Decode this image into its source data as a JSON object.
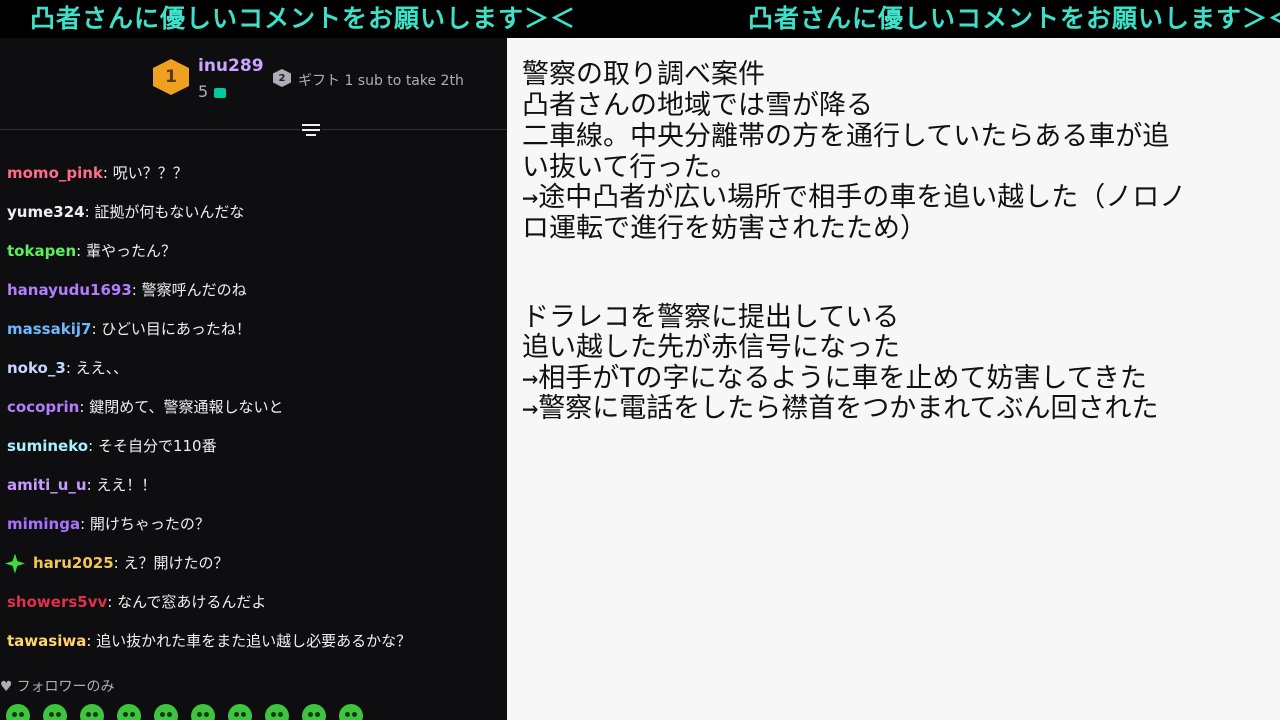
{
  "ticker": {
    "text": "凸者さんに優しいコメントをお願いします＞＜",
    "text_repeat": "凸者さんに優しいコメントをお願いします＞＜"
  },
  "pinned": {
    "rank1": "1",
    "user": "inu289",
    "count": "5",
    "rank2": "2",
    "message": "ギフト 1 sub to take 2th"
  },
  "chat": [
    {
      "user": "momo_pink",
      "color": "#ff6b8a",
      "text": "呪い？？？"
    },
    {
      "user": "yume324",
      "color": "#efeff1",
      "text": "証拠が何もないんだな"
    },
    {
      "user": "tokapen",
      "color": "#5cf05c",
      "text": "輩やったん？"
    },
    {
      "user": "hanayudu1693",
      "color": "#b37dff",
      "text": "警察呼んだのね"
    },
    {
      "user": "massakij7",
      "color": "#6fb7ff",
      "text": "ひどい目にあったね！"
    },
    {
      "user": "noko_3",
      "color": "#c9d6ff",
      "text": "ええ、、"
    },
    {
      "user": "cocoprin",
      "color": "#b37dff",
      "text": "鍵閉めて、警察通報しないと"
    },
    {
      "user": "sumineko",
      "color": "#a8f0ff",
      "text": "そそ自分で110番"
    },
    {
      "user": "amiti_u_u",
      "color": "#c99aff",
      "text": "ええ！！"
    },
    {
      "user": "miminga",
      "color": "#a970ff",
      "text": "開けちゃったの？"
    },
    {
      "user": "haru2025",
      "color": "#f3c45a",
      "text": "え？開けたの？",
      "badge": "sparkle-badge"
    },
    {
      "user": "showers5vv",
      "color": "#e0304a",
      "text": "なんで窓あけるんだよ"
    },
    {
      "user": "tawasiwa",
      "color": "#ffd56b",
      "text": "追い抜かれた車をまた追い越し必要あるかな？"
    }
  ],
  "followers_only": "フォロワーのみ",
  "notes": [
    "警察の取り調べ案件",
    "凸者さんの地域では雪が降る",
    "二車線。中央分離帯の方を通行していたらある車が追",
    "い抜いて行った。",
    "→途中凸者が広い場所で相手の車を追い越した（ノロノ",
    "ロ運転で進行を妨害されたため）",
    "",
    "",
    "ドラレコを警察に提出している",
    "追い越した先が赤信号になった",
    "→相手がTの字になるように車を止めて妨害してきた",
    "→警察に電話をしたら襟首をつかまれてぶん回された"
  ]
}
